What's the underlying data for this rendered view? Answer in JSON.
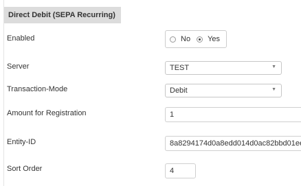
{
  "section": {
    "title": "Direct Debit (SEPA Recurring)"
  },
  "fields": {
    "enabled": {
      "label": "Enabled",
      "options": [
        "No",
        "Yes"
      ],
      "selected": "Yes"
    },
    "server": {
      "label": "Server",
      "value": "TEST"
    },
    "transaction_mode": {
      "label": "Transaction-Mode",
      "value": "Debit"
    },
    "amount_registration": {
      "label": "Amount for Registration",
      "value": "1"
    },
    "entity_id": {
      "label": "Entity-ID",
      "value": "8a8294174d0a8edd014d0ac82bbd01ee"
    },
    "sort_order": {
      "label": "Sort Order",
      "value": "4"
    }
  },
  "icons": {
    "select_arrow": "chevron-down-icon"
  },
  "colors": {
    "section_header_bg": "#dcdcdc",
    "border": "#cccccc",
    "text": "#333333"
  }
}
